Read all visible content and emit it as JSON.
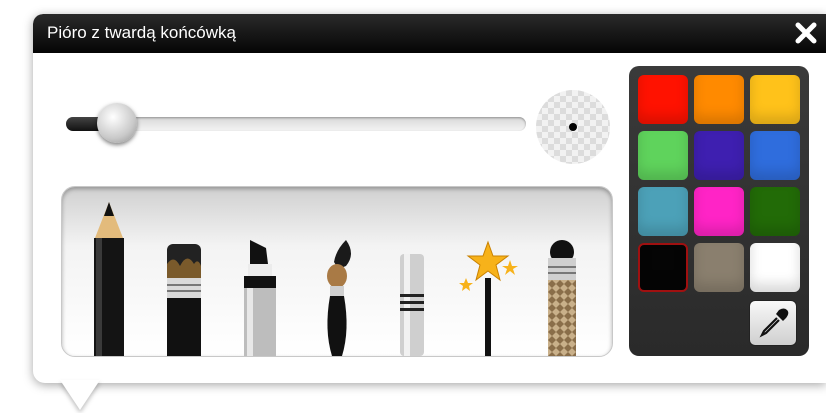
{
  "window": {
    "title": "Pióro z twardą końcówką",
    "close_icon": "close-icon"
  },
  "thickness_slider": {
    "value_fraction": 0.11
  },
  "preview": {
    "icon": "brush-size-preview-dot",
    "dot_color": "#000000"
  },
  "tools": [
    {
      "id": "pencil",
      "icon": "pencil-icon"
    },
    {
      "id": "marker",
      "icon": "marker-icon"
    },
    {
      "id": "highlighter",
      "icon": "highlighter-icon"
    },
    {
      "id": "brush",
      "icon": "paintbrush-icon"
    },
    {
      "id": "hard-tip-pen",
      "icon": "hard-tip-pen-icon"
    },
    {
      "id": "magic-wand",
      "icon": "magic-wand-icon"
    },
    {
      "id": "texture-brush",
      "icon": "texture-brush-icon"
    }
  ],
  "palette": {
    "colors": [
      "#ff1200",
      "#ff8a00",
      "#ffc21a",
      "#5fd35c",
      "#3e1fb0",
      "#2f6ddd",
      "#4ca1b8",
      "#ff24c6",
      "#226b07",
      "#050505",
      "#8a7f6e",
      "#ffffff"
    ],
    "selected_index": 9,
    "eyedropper_icon": "eyedropper-icon"
  }
}
